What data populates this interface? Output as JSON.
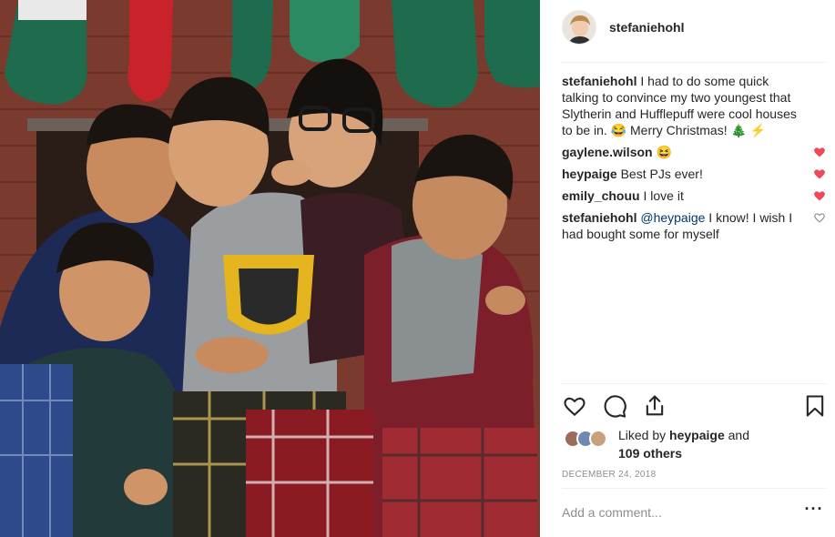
{
  "post": {
    "photo_icon": "family-christmas-photo",
    "author": "stefaniehohl"
  },
  "caption": {
    "user": "stefaniehohl",
    "text": "I had to do some quick talking to convince my two youngest that Slytherin and Hufflepuff were cool houses to be in. 😂 Merry Christmas! 🎄 ⚡️"
  },
  "comments": [
    {
      "user": "gaylene.wilson",
      "text": "😆",
      "liked": true
    },
    {
      "user": "heypaige",
      "text": "Best PJs ever!",
      "liked": true
    },
    {
      "user": "emily_chouu",
      "text": "I love it",
      "liked": true
    },
    {
      "user": "stefaniehohl",
      "mention": "@heypaige",
      "text": "I know! I wish I had bought some for myself",
      "liked": false
    }
  ],
  "actions": {
    "like_icon": "heart-icon",
    "comment_icon": "comment-icon",
    "share_icon": "share-icon",
    "save_icon": "bookmark-icon"
  },
  "likes": {
    "prefix": "Liked by",
    "user": "heypaige",
    "middle": "and",
    "others": "109 others"
  },
  "date": "DECEMBER 24, 2018",
  "composer": {
    "placeholder": "Add a comment...",
    "more_label": "···"
  },
  "colors": {
    "heart_red": "#ed4956",
    "mention_blue": "#00376b",
    "muted": "#8e8e8e",
    "text": "#262626"
  }
}
